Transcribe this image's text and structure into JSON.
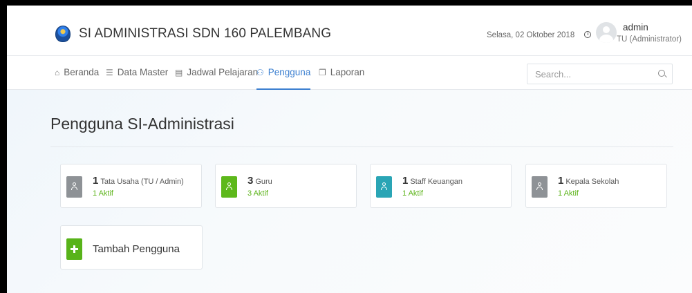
{
  "header": {
    "app_title": "SI ADMINISTRASI SDN 160 PALEMBANG",
    "date": "Selasa, 02 Oktober 2018",
    "user": {
      "name": "admin",
      "role": "TU (Administrator)"
    }
  },
  "nav": {
    "items": [
      {
        "label": "Beranda",
        "icon": "home-icon"
      },
      {
        "label": "Data Master",
        "icon": "database-icon"
      },
      {
        "label": "Jadwal Pelajaran",
        "icon": "calendar-icon"
      },
      {
        "label": "Pengguna",
        "icon": "users-icon",
        "active": true
      },
      {
        "label": "Laporan",
        "icon": "copy-icon"
      }
    ],
    "search": {
      "placeholder": "Search...",
      "value": ""
    }
  },
  "main": {
    "title": "Pengguna SI-Administrasi",
    "cards": [
      {
        "count": "1",
        "label": "Tata Usaha (TU / Admin)",
        "status": "1 Aktif",
        "color": "#8e9296"
      },
      {
        "count": "3",
        "label": "Guru",
        "status": "3 Aktif",
        "color": "#5db81b"
      },
      {
        "count": "1",
        "label": "Staff Keuangan",
        "status": "1 Aktif",
        "color": "#2aa5b5"
      },
      {
        "count": "1",
        "label": "Kepala Sekolah",
        "status": "1 Aktif",
        "color": "#8e9296"
      }
    ],
    "add_button": {
      "label": "Tambah Pengguna",
      "color": "#58b31a"
    }
  }
}
